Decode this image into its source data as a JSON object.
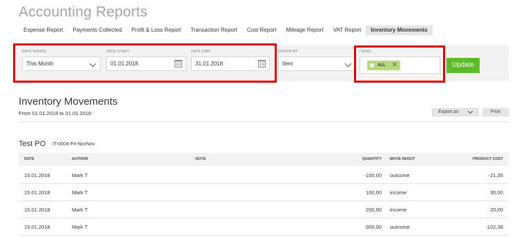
{
  "page": {
    "title": "Accounting Reports"
  },
  "tabs": [
    {
      "label": "Expense Report",
      "active": false
    },
    {
      "label": "Payments Collected",
      "active": false
    },
    {
      "label": "Profit & Loss Report",
      "active": false
    },
    {
      "label": "Transaction Report",
      "active": false
    },
    {
      "label": "Cost Report",
      "active": false
    },
    {
      "label": "Mileage Report",
      "active": false
    },
    {
      "label": "VAT Report",
      "active": false
    },
    {
      "label": "Inventory Movements",
      "active": true
    }
  ],
  "filters": {
    "date_range": {
      "label": "DATE RANGE:",
      "value": "This Month"
    },
    "date_start": {
      "label": "DATE START:",
      "value": "01.01.2018"
    },
    "date_end": {
      "label": "DATE END:",
      "value": "31.01.2018"
    },
    "group_by": {
      "label": "GROUP BY",
      "value": "Item"
    },
    "items": {
      "label": "ITEMS",
      "chip": "ALL"
    },
    "update_label": "Update"
  },
  "report": {
    "title": "Inventory Movements",
    "subtitle": "From 01.01.2018 to 31.01.2018",
    "export_label": "Export as",
    "print_label": "Print"
  },
  "group": {
    "title": "Test PO",
    "id": "IT-0004-Fri-NovNov"
  },
  "table": {
    "headers": {
      "date": "DATE",
      "author": "AUTHOR",
      "note": "NOTE",
      "quantity": "QUANTITY",
      "move": "MOVE IN/OUT",
      "cost": "PRODUCT COST"
    },
    "rows": [
      {
        "date": "15.01.2018",
        "author": "Mark T",
        "note": "",
        "quantity": "-100,00",
        "move": "outcome",
        "cost": "-21,35"
      },
      {
        "date": "15.01.2018",
        "author": "Mark T",
        "note": "",
        "quantity": "100,00",
        "move": "income",
        "cost": "35,00"
      },
      {
        "date": "15.01.2018",
        "author": "Mark T",
        "note": "",
        "quantity": "200,00",
        "move": "income",
        "cost": "20,00"
      },
      {
        "date": "15.01.2018",
        "author": "Mark T",
        "note": "",
        "quantity": "-300,00",
        "move": "outcome",
        "cost": "-102,38"
      }
    ]
  },
  "colors": {
    "accent_green": "#5bbb2a",
    "highlight_red": "#e00000",
    "chip_green": "#b6d982"
  }
}
